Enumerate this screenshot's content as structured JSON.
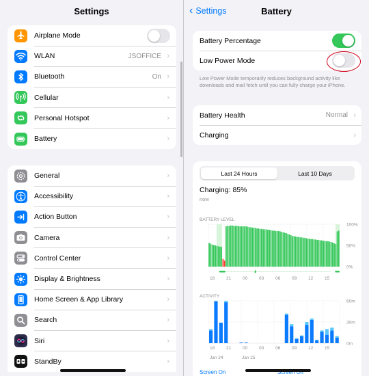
{
  "left": {
    "title": "Settings",
    "group1": [
      {
        "label": "Airplane Mode",
        "icon": "airplane-icon",
        "color": "#ff9500",
        "toggle": false
      },
      {
        "label": "WLAN",
        "icon": "wifi-icon",
        "color": "#007aff",
        "value": "JSOFFICE"
      },
      {
        "label": "Bluetooth",
        "icon": "bluetooth-icon",
        "color": "#007aff",
        "value": "On"
      },
      {
        "label": "Cellular",
        "icon": "antenna-icon",
        "color": "#34c759"
      },
      {
        "label": "Personal Hotspot",
        "icon": "link-icon",
        "color": "#34c759"
      },
      {
        "label": "Battery",
        "icon": "battery-icon",
        "color": "#34c759"
      }
    ],
    "group2": [
      {
        "label": "General",
        "icon": "gear-icon",
        "color": "#8e8e93"
      },
      {
        "label": "Accessibility",
        "icon": "accessibility-icon",
        "color": "#007aff"
      },
      {
        "label": "Action Button",
        "icon": "action-button-icon",
        "color": "#007aff"
      },
      {
        "label": "Camera",
        "icon": "camera-icon",
        "color": "#8e8e93"
      },
      {
        "label": "Control Center",
        "icon": "switches-icon",
        "color": "#8e8e93"
      },
      {
        "label": "Display & Brightness",
        "icon": "sun-icon",
        "color": "#007aff"
      },
      {
        "label": "Home Screen & App Library",
        "icon": "phone-icon",
        "color": "#007aff"
      },
      {
        "label": "Search",
        "icon": "search-icon",
        "color": "#8e8e93"
      },
      {
        "label": "Siri",
        "icon": "siri-icon",
        "color": "#2b2b4a"
      },
      {
        "label": "StandBy",
        "icon": "standby-icon",
        "color": "#111111"
      }
    ]
  },
  "right": {
    "back_label": "Settings",
    "title": "Battery",
    "group1": [
      {
        "label": "Battery Percentage",
        "toggle": true
      },
      {
        "label": "Low Power Mode",
        "toggle": false
      }
    ],
    "lpm_note": "Low Power Mode temporarily reduces background activity like downloads and mail fetch until you can fully charge your iPhone.",
    "group2": [
      {
        "label": "Battery Health",
        "value": "Normal"
      },
      {
        "label": "Charging",
        "value": ""
      }
    ],
    "segments": [
      "Last 24 Hours",
      "Last 10 Days"
    ],
    "charging_label": "Charging: 85%",
    "charging_time": "now",
    "legend_left": "Screen On",
    "legend_right": "Screen Off"
  },
  "chart_data": [
    {
      "type": "bar",
      "title": "BATTERY LEVEL",
      "ylabel": "",
      "y_ticks": [
        "100%",
        "50%",
        "0%"
      ],
      "ylim": [
        0,
        100
      ],
      "x_tick_labels": [
        "18",
        "21",
        "00",
        "03",
        "06",
        "09",
        "12",
        "15"
      ],
      "values": [
        56,
        54,
        52,
        51,
        50,
        49,
        48,
        47,
        47,
        18,
        14,
        95,
        96,
        96,
        97,
        97,
        96,
        96,
        96,
        96,
        95,
        95,
        95,
        95,
        95,
        94,
        93,
        93,
        92,
        92,
        91,
        90,
        90,
        89,
        89,
        88,
        88,
        88,
        87,
        87,
        86,
        85,
        85,
        84,
        84,
        84,
        83,
        82,
        81,
        80,
        79,
        77,
        76,
        74,
        72,
        72,
        71,
        70,
        70,
        69,
        69,
        68,
        68,
        67,
        66,
        66,
        65,
        65,
        64,
        64,
        63,
        63,
        62,
        62,
        61,
        61,
        60,
        60,
        59,
        58,
        57,
        55,
        53,
        83,
        85
      ],
      "low_values": [
        0,
        0,
        0,
        0,
        0,
        0,
        0,
        0,
        0,
        1,
        1,
        0,
        0,
        0,
        0,
        0,
        0,
        0,
        0,
        0,
        0,
        0,
        0,
        0,
        0,
        0,
        0,
        0,
        0,
        0,
        0,
        0,
        0,
        0,
        0,
        0,
        0,
        0,
        0,
        0,
        0,
        0,
        0,
        0,
        0,
        0,
        0,
        0,
        0,
        0,
        0,
        0,
        0,
        0,
        0,
        0,
        0,
        0,
        0,
        0,
        0,
        0,
        0,
        0,
        0,
        0,
        0,
        0,
        0,
        0,
        0,
        0,
        0,
        0,
        0,
        0,
        0,
        0,
        0,
        0,
        0,
        0,
        0,
        0,
        0
      ]
    },
    {
      "type": "bar",
      "title": "ACTIVITY",
      "y_ticks": [
        "60m",
        "30m",
        "0m"
      ],
      "ylim": [
        0,
        60
      ],
      "x_tick_labels": [
        "18",
        "21",
        "00",
        "03",
        "06",
        "09",
        "12",
        "15"
      ],
      "date_labels": [
        "Jan 24",
        "Jan 25"
      ],
      "legend": [
        "Screen On",
        "Screen Off"
      ],
      "colors": {
        "screen_on": "#0a7aff",
        "screen_off": "#5ac8fa"
      },
      "series": [
        {
          "name": "Screen On",
          "values": [
            18,
            59,
            29,
            58,
            0,
            0,
            1,
            1,
            0,
            0,
            0,
            0,
            0,
            0,
            0,
            40,
            24,
            6,
            10,
            26,
            33,
            4,
            16,
            12,
            18,
            8
          ]
        },
        {
          "name": "Screen Off",
          "values": [
            2,
            1,
            0,
            2,
            0,
            0,
            0,
            0,
            0,
            0,
            0,
            0,
            0,
            0,
            0,
            2,
            3,
            1,
            1,
            4,
            2,
            1,
            2,
            8,
            4,
            2
          ]
        }
      ]
    }
  ]
}
